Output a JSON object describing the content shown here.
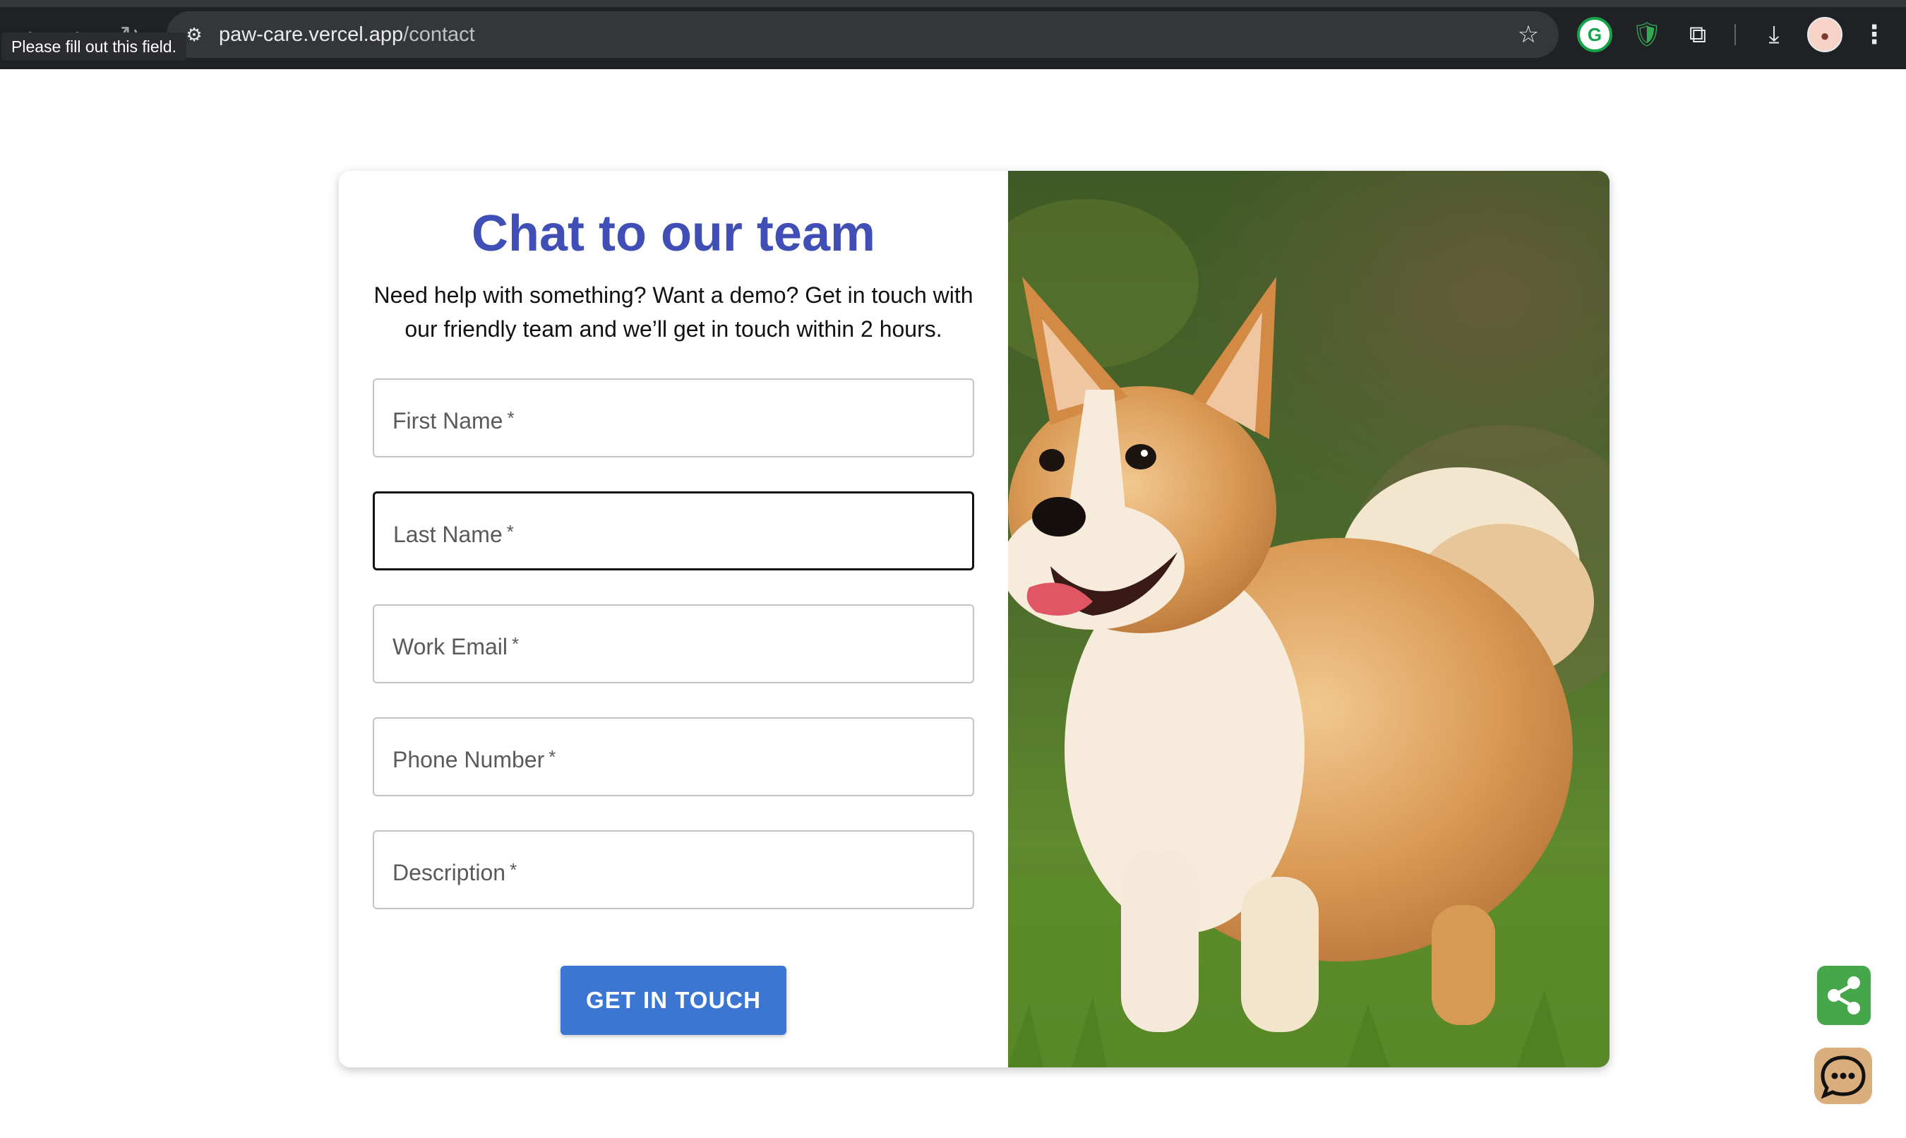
{
  "browser": {
    "url_host": "paw-care.vercel.app",
    "url_path": "/contact",
    "tooltip": "Please fill out this field.",
    "icons": [
      "back-icon",
      "forward-icon",
      "reload-icon",
      "site-info-icon",
      "star-icon",
      "grammarly-icon",
      "shield-extension-icon",
      "extensions-puzzle-icon",
      "download-icon",
      "profile-avatar",
      "more-menu-icon"
    ]
  },
  "form": {
    "title": "Chat to our team",
    "subtitle": "Need help with something? Want a demo? Get in touch with our friendly team and we’ll get in touch within 2 hours.",
    "fields": [
      {
        "label": "First Name",
        "required_mark": "*"
      },
      {
        "label": "Last Name",
        "required_mark": "*"
      },
      {
        "label": "Work Email",
        "required_mark": "*"
      },
      {
        "label": "Phone Number",
        "required_mark": "*"
      },
      {
        "label": "Description",
        "required_mark": "*"
      }
    ],
    "focused_field": "Last Name",
    "submit_label": "GET IN TOUCH"
  },
  "floating_actions": {
    "icons": [
      "share-icon",
      "chat-bubble-icon"
    ]
  },
  "colors": {
    "title": "#3f4fb5",
    "button": "#3a76d2",
    "share_fab": "#46a74a",
    "chat_fab": "#d9ad7c",
    "chrome": "#202124"
  }
}
